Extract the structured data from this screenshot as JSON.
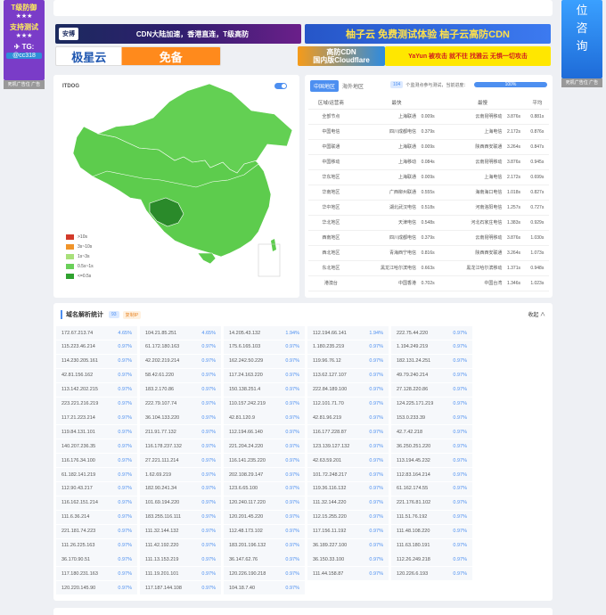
{
  "side_left": {
    "line1": "T级防御",
    "line2": "★★★",
    "line3": "支持测试",
    "line4": "★★★",
    "tg": "✈ TG:",
    "handle": "@cc318",
    "caption": "死机广告位 广告"
  },
  "side_right": {
    "lines": [
      "位",
      "咨",
      "询"
    ],
    "caption": "死机广告位 广告"
  },
  "banners": {
    "b1_logo": "安博",
    "b1_text": "CDN大陆加速，香港直连，T级高防",
    "b2_text": "柚子云 免费测试体验 柚子云高防CDN",
    "b3_text_a": "极星云",
    "b3_text_b": "免备",
    "b4_line1": "高防CDN",
    "b4_line2": "国内版Cloudflare",
    "b5_text": "YaYun 被攻击 就不往 找雅云 无惧一切攻击"
  },
  "map": {
    "logo": "ITDOG",
    "legend": [
      {
        "label": ">10s",
        "color": "#d23a2a"
      },
      {
        "label": "3s~10s",
        "color": "#f0942a"
      },
      {
        "label": "1s~3s",
        "color": "#a8e07a"
      },
      {
        "label": "0.5s~1s",
        "color": "#6ad05a"
      },
      {
        "label": "<=0.5s",
        "color": "#2fa22f"
      }
    ]
  },
  "speed": {
    "tab_active": "中国地区",
    "tab_inactive": "海外地区",
    "node_count": "104",
    "node_text": "个监测点参与测试，当前进度：",
    "progress": "100%",
    "headers": [
      "区域/运营商",
      "最快",
      "最慢",
      "平均"
    ],
    "rows": [
      [
        "全部节点",
        "上海联通",
        "0.009s",
        "云南昆明移动",
        "3.876s",
        "0.881s"
      ],
      [
        "中国电信",
        "四川成都电信",
        "0.379s",
        "上海电信",
        "2.172s",
        "0.876s"
      ],
      [
        "中国联通",
        "上海联通",
        "0.009s",
        "陕西西安联通",
        "3.264s",
        "0.847s"
      ],
      [
        "中国移动",
        "上海移动",
        "0.084s",
        "云南昆明移动",
        "3.876s",
        "0.945s"
      ],
      [
        "华东地区",
        "上海联通",
        "0.009s",
        "上海电信",
        "2.172s",
        "0.699s"
      ],
      [
        "华南地区",
        "广西柳州联通",
        "0.555s",
        "海南海口电信",
        "1.018s",
        "0.827s"
      ],
      [
        "华中地区",
        "湖北武汉电信",
        "0.518s",
        "河南洛阳电信",
        "1.257s",
        "0.727s"
      ],
      [
        "华北地区",
        "天津电信",
        "0.548s",
        "河北石家庄电信",
        "1.383s",
        "0.929s"
      ],
      [
        "西南地区",
        "四川成都电信",
        "0.379s",
        "云南昆明移动",
        "3.876s",
        "1.030s"
      ],
      [
        "西北地区",
        "青海西宁电信",
        "0.816s",
        "陕西西安联通",
        "3.264s",
        "1.073s"
      ],
      [
        "东北地区",
        "黑龙江哈尔滨电信",
        "0.663s",
        "黑龙江哈尔滨移动",
        "1.371s",
        "0.948s"
      ],
      [
        "港澳台",
        "中国香港",
        "0.702s",
        "中国台湾",
        "1.346s",
        "1.023s"
      ]
    ]
  },
  "dns": {
    "title": "域名解析统计",
    "count": "93",
    "refresh": "复制IP",
    "collapse": "收起 ∧",
    "rows": [
      [
        [
          "172.67.213.74",
          "4.65%"
        ],
        [
          "104.21.85.251",
          "4.65%"
        ],
        [
          "14.205.43.132",
          "1.94%"
        ],
        [
          "112.194.66.141",
          "1.94%"
        ],
        [
          "222.75.44.220",
          "0.97%"
        ]
      ],
      [
        [
          "115.223.46.214",
          "0.97%"
        ],
        [
          "61.172.180.163",
          "0.97%"
        ],
        [
          "175.6.165.103",
          "0.97%"
        ],
        [
          "1.180.235.219",
          "0.97%"
        ],
        [
          "1.194.249.219",
          "0.97%"
        ]
      ],
      [
        [
          "114.230.205.161",
          "0.97%"
        ],
        [
          "42.202.219.214",
          "0.97%"
        ],
        [
          "162.242.50.229",
          "0.97%"
        ],
        [
          "119.96.76.12",
          "0.97%"
        ],
        [
          "182.131.24.251",
          "0.97%"
        ]
      ],
      [
        [
          "42.81.156.162",
          "0.97%"
        ],
        [
          "58.42.61.220",
          "0.97%"
        ],
        [
          "117.24.163.220",
          "0.97%"
        ],
        [
          "113.62.127.107",
          "0.97%"
        ],
        [
          "49.79.240.214",
          "0.97%"
        ]
      ],
      [
        [
          "113.142.202.215",
          "0.97%"
        ],
        [
          "183.2.170.86",
          "0.97%"
        ],
        [
          "150.138.251.4",
          "0.97%"
        ],
        [
          "222.84.189.100",
          "0.97%"
        ],
        [
          "27.128.220.86",
          "0.97%"
        ]
      ],
      [
        [
          "223.221.216.219",
          "0.97%"
        ],
        [
          "222.79.107.74",
          "0.97%"
        ],
        [
          "110.157.242.219",
          "0.97%"
        ],
        [
          "112.101.71.70",
          "0.97%"
        ],
        [
          "124.225.171.219",
          "0.97%"
        ]
      ],
      [
        [
          "117.21.223.214",
          "0.97%"
        ],
        [
          "36.104.133.220",
          "0.97%"
        ],
        [
          "42.81.120.9",
          "0.97%"
        ],
        [
          "42.81.96.219",
          "0.97%"
        ],
        [
          "153.0.233.39",
          "0.97%"
        ]
      ],
      [
        [
          "119.84.131.101",
          "0.97%"
        ],
        [
          "211.91.77.132",
          "0.97%"
        ],
        [
          "112.194.66.140",
          "0.97%"
        ],
        [
          "116.177.228.87",
          "0.97%"
        ],
        [
          "42.7.42.218",
          "0.97%"
        ]
      ],
      [
        [
          "140.207.236.35",
          "0.97%"
        ],
        [
          "116.178.237.132",
          "0.97%"
        ],
        [
          "221.204.24.220",
          "0.97%"
        ],
        [
          "123.139.127.132",
          "0.97%"
        ],
        [
          "36.250.251.220",
          "0.97%"
        ]
      ],
      [
        [
          "116.176.34.100",
          "0.97%"
        ],
        [
          "27.221.111.214",
          "0.97%"
        ],
        [
          "116.141.235.220",
          "0.97%"
        ],
        [
          "42.63.59.201",
          "0.97%"
        ],
        [
          "113.194.45.232",
          "0.97%"
        ]
      ],
      [
        [
          "61.182.141.219",
          "0.97%"
        ],
        [
          "1.62.69.219",
          "0.97%"
        ],
        [
          "202.108.29.147",
          "0.97%"
        ],
        [
          "101.72.248.217",
          "0.97%"
        ],
        [
          "112.83.164.214",
          "0.97%"
        ]
      ],
      [
        [
          "112.90.43.217",
          "0.97%"
        ],
        [
          "182.90.241.34",
          "0.97%"
        ],
        [
          "123.6.65.100",
          "0.97%"
        ],
        [
          "119.36.116.132",
          "0.97%"
        ],
        [
          "61.162.174.55",
          "0.97%"
        ]
      ],
      [
        [
          "116.162.151.214",
          "0.97%"
        ],
        [
          "101.69.194.220",
          "0.97%"
        ],
        [
          "120.240.117.220",
          "0.97%"
        ],
        [
          "111.32.144.220",
          "0.97%"
        ],
        [
          "221.176.81.102",
          "0.97%"
        ]
      ],
      [
        [
          "111.6.36.214",
          "0.97%"
        ],
        [
          "183.255.116.111",
          "0.97%"
        ],
        [
          "120.201.45.220",
          "0.97%"
        ],
        [
          "112.15.255.220",
          "0.97%"
        ],
        [
          "111.51.76.192",
          "0.97%"
        ]
      ],
      [
        [
          "221.181.74.223",
          "0.97%"
        ],
        [
          "111.32.144.132",
          "0.97%"
        ],
        [
          "112.48.173.102",
          "0.97%"
        ],
        [
          "117.156.11.192",
          "0.97%"
        ],
        [
          "111.48.108.220",
          "0.97%"
        ]
      ],
      [
        [
          "111.26.225.163",
          "0.97%"
        ],
        [
          "111.42.192.220",
          "0.97%"
        ],
        [
          "183.201.196.132",
          "0.97%"
        ],
        [
          "36.189.227.100",
          "0.97%"
        ],
        [
          "111.63.180.191",
          "0.97%"
        ]
      ],
      [
        [
          "36.170.90.51",
          "0.97%"
        ],
        [
          "111.13.153.219",
          "0.97%"
        ],
        [
          "36.147.62.76",
          "0.97%"
        ],
        [
          "36.150.33.100",
          "0.97%"
        ],
        [
          "112.26.249.218",
          "0.97%"
        ]
      ],
      [
        [
          "117.180.231.163",
          "0.97%"
        ],
        [
          "111.19.201.101",
          "0.97%"
        ],
        [
          "120.226.190.218",
          "0.97%"
        ],
        [
          "111.44.158.87",
          "0.97%"
        ],
        [
          "120.226.6.193",
          "0.97%"
        ]
      ],
      [
        [
          "120.220.145.90",
          "0.97%"
        ],
        [
          "117.187.144.108",
          "0.97%"
        ],
        [
          "104.18.7.40",
          "0.97%"
        ]
      ]
    ]
  }
}
